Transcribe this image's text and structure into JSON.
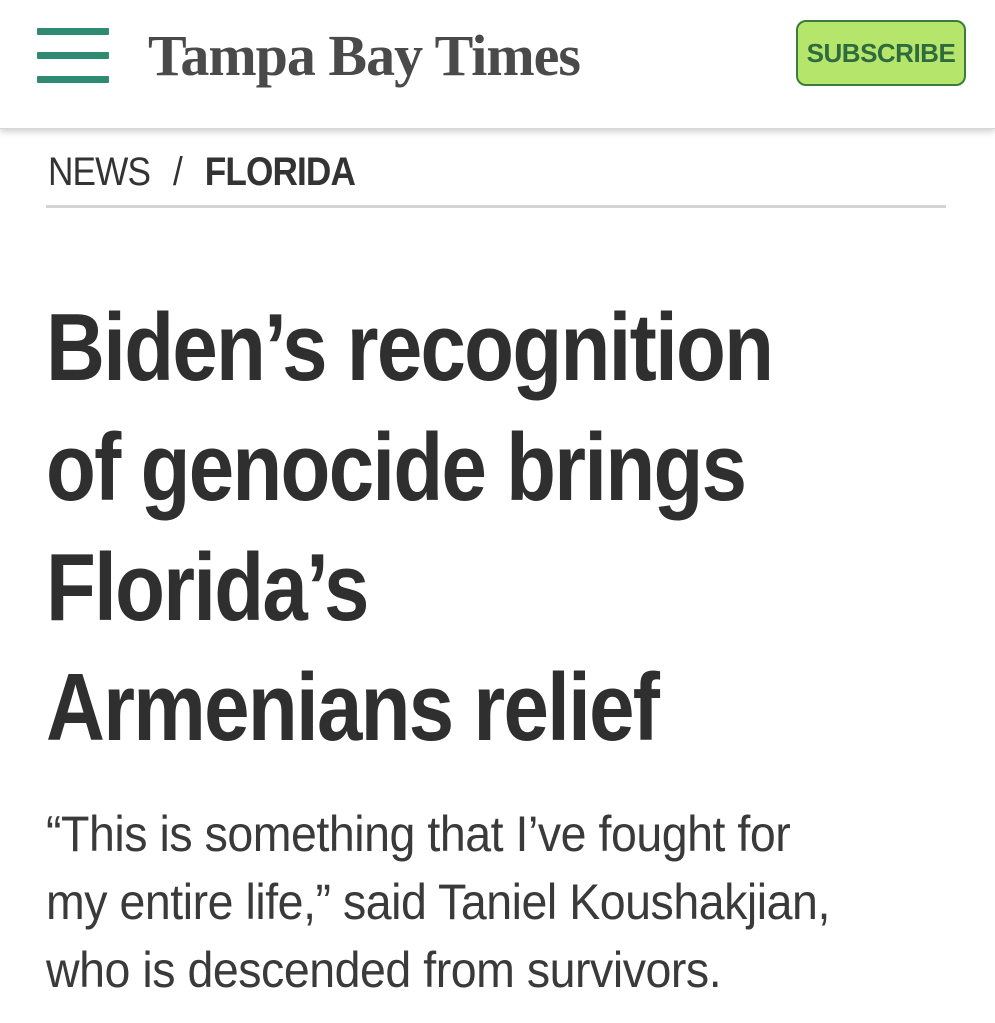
{
  "header": {
    "logo_text": "Tampa Bay Times",
    "subscribe_label": "SUBSCRIBE",
    "menu_icon": "hamburger-menu-icon",
    "colors": {
      "menu_icon": "#2e8b72",
      "subscribe_bg": "#b6e56b",
      "subscribe_text": "#2e6b3f",
      "subscribe_border": "#3d7b3d"
    }
  },
  "breadcrumb": {
    "section": "NEWS",
    "separator": "/",
    "subsection": "FLORIDA"
  },
  "article": {
    "headline_lines": [
      "Biden’s recognition",
      "of genocide brings",
      "Florida’s",
      "Armenians relief"
    ],
    "dek_lines": [
      "“This is something that I’ve fought for",
      "my entire life,” said Taniel Koushakjian,",
      "who is descended from survivors."
    ]
  }
}
